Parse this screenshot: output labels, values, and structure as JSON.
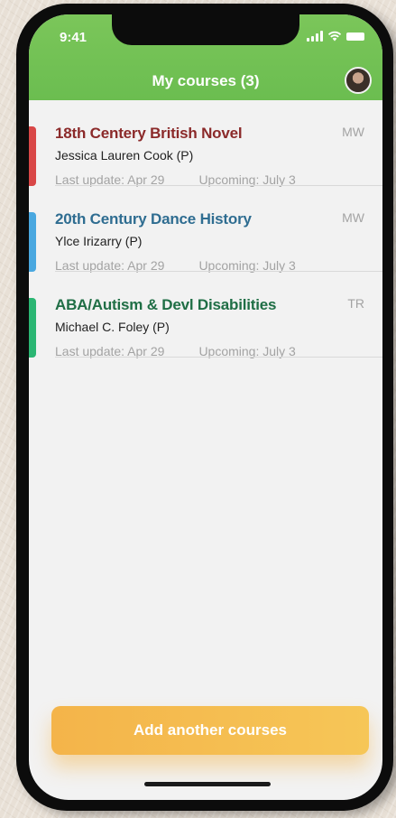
{
  "status_bar": {
    "time": "9:41"
  },
  "header": {
    "title": "My courses (3)"
  },
  "colors": {
    "header_green": "#6bbd50",
    "button_orange": "#f4b44a"
  },
  "courses": [
    {
      "name": "18th Centery British Novel",
      "professor": "Jessica Lauren Cook (P)",
      "last_update": "Last update: Apr 29",
      "upcoming": "Upcoming: July 3",
      "days": "MW",
      "accent_color": "#d94747",
      "title_color": "#8b2a2a"
    },
    {
      "name": "20th Century Dance History",
      "professor": "Ylce Irizarry (P)",
      "last_update": "Last update: Apr 29",
      "upcoming": "Upcoming: July 3",
      "days": "MW",
      "accent_color": "#4aa8e0",
      "title_color": "#2f6d91"
    },
    {
      "name": "ABA/Autism & Devl Disabilities",
      "professor": "Michael C. Foley (P)",
      "last_update": "Last update: Apr 29",
      "upcoming": "Upcoming: July 3",
      "days": "TR",
      "accent_color": "#2bb673",
      "title_color": "#1f6e45"
    }
  ],
  "actions": {
    "add_course_label": "Add another courses"
  }
}
